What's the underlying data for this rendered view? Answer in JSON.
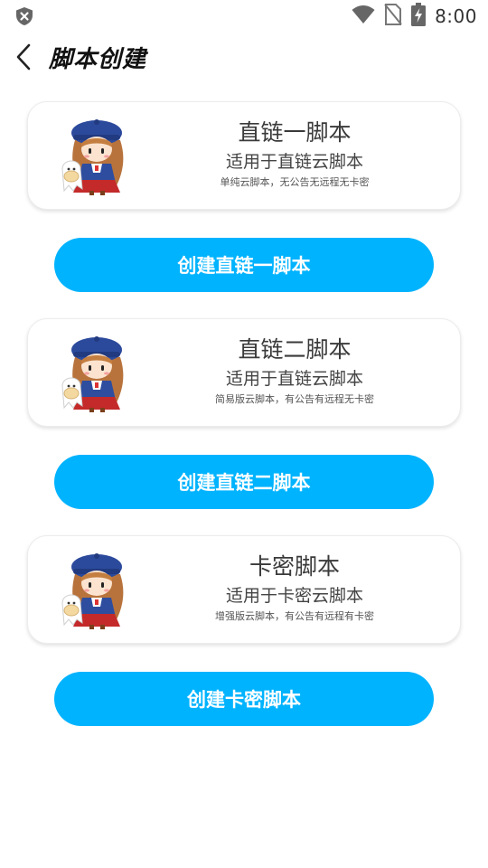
{
  "status_bar": {
    "time": "8:00",
    "icons": [
      "shield-icon",
      "wifi-icon",
      "no-sim-icon",
      "battery-charging-icon"
    ]
  },
  "header": {
    "back_icon": "chevron-left-icon",
    "title": "脚本创建"
  },
  "cards": [
    {
      "title": "直链一脚本",
      "subtitle": "适用于直链云脚本",
      "description": "单纯云脚本，无公告无远程无卡密",
      "button_label": "创建直链一脚本"
    },
    {
      "title": "直链二脚本",
      "subtitle": "适用于直链云脚本",
      "description": "简易版云脚本，有公告有远程无卡密",
      "button_label": "创建直链二脚本"
    },
    {
      "title": "卡密脚本",
      "subtitle": "适用于卡密云脚本",
      "description": "增强版云脚本，有公告有远程有卡密",
      "button_label": "创建卡密脚本"
    }
  ],
  "colors": {
    "accent": "#00b3ff",
    "card_border": "#ececec",
    "title_text": "#3a3a3a"
  }
}
